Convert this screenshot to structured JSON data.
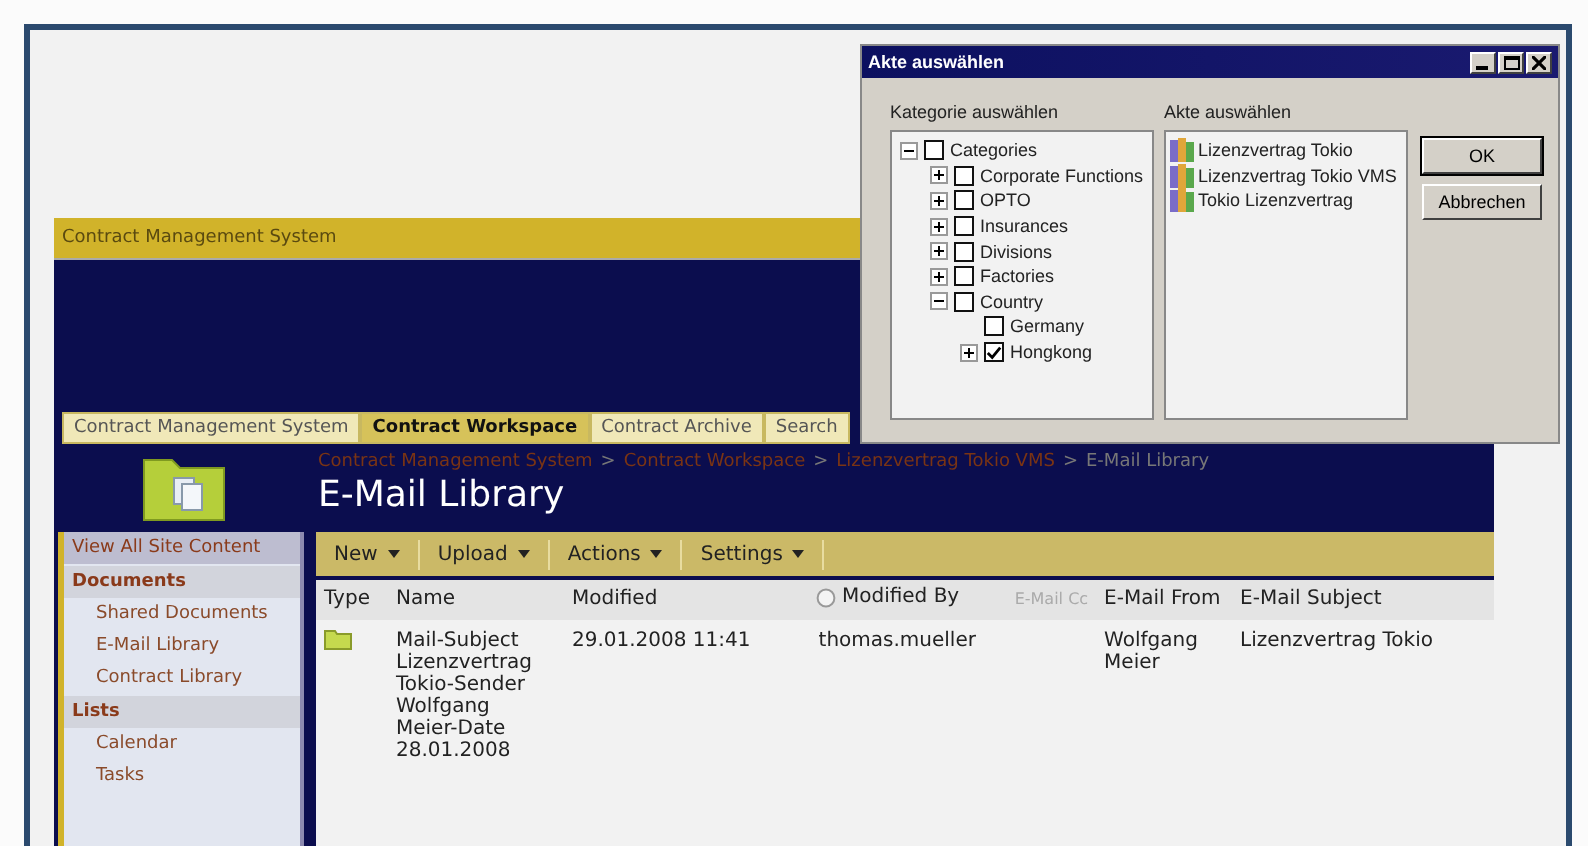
{
  "app": {
    "title": "Contract Management System",
    "tabs": [
      {
        "label": "Contract Management System",
        "selected": false
      },
      {
        "label": "Contract Workspace",
        "selected": true
      },
      {
        "label": "Contract Archive",
        "selected": false
      },
      {
        "label": "Search",
        "selected": false
      }
    ],
    "breadcrumb": [
      {
        "label": "Contract Management System",
        "link": true
      },
      {
        "separator": ">",
        "label": "Contract Workspace",
        "link": true
      },
      {
        "separator": ">",
        "label": "Lizenzvertrag Tokio VMS",
        "link": true
      },
      {
        "separator": ">",
        "label": "E-Mail Library",
        "link": false
      }
    ],
    "page_title": "E-Mail Library",
    "sidebar": {
      "view_all": "View All Site Content",
      "sections": [
        {
          "heading": "Documents",
          "items": [
            "Shared Documents",
            "E-Mail Library",
            "Contract Library"
          ]
        },
        {
          "heading": "Lists",
          "items": [
            "Calendar",
            "Tasks"
          ]
        }
      ]
    },
    "toolbar": [
      "New",
      "Upload",
      "Actions",
      "Settings"
    ],
    "table": {
      "columns": [
        {
          "label": "Type",
          "dimmed": false,
          "icon": false
        },
        {
          "label": "Name",
          "dimmed": false,
          "icon": false
        },
        {
          "label": "Modified",
          "dimmed": false,
          "icon": false
        },
        {
          "label": "Modified By",
          "dimmed": false,
          "icon": true
        },
        {
          "label": "E-Mail Cc",
          "dimmed": true,
          "icon": false
        },
        {
          "label": "E-Mail From",
          "dimmed": false,
          "icon": false
        },
        {
          "label": "E-Mail Subject",
          "dimmed": false,
          "icon": false
        }
      ],
      "rows": [
        {
          "kind": "folder",
          "cells": [
            "",
            "Mail-Subject Lizenzvertrag Tokio-Sender Wolfgang Meier-Date 28.01.2008",
            "29.01.2008 11:41",
            "thomas.mueller",
            "",
            "Wolfgang Meier",
            "Lizenzvertrag Tokio"
          ]
        }
      ]
    }
  },
  "dialog": {
    "title": "Akte auswählen",
    "category_label": "Kategorie auswählen",
    "files_label": "Akte auswählen",
    "tree": [
      {
        "label": "Categories",
        "checked": false,
        "expanded": true,
        "children": [
          {
            "label": "Corporate Functions",
            "checked": false,
            "expanded": false
          },
          {
            "label": "OPTO",
            "checked": false,
            "expanded": false
          },
          {
            "label": "Insurances",
            "checked": false,
            "expanded": false
          },
          {
            "label": "Divisions",
            "checked": false,
            "expanded": false
          },
          {
            "label": "Factories",
            "checked": false,
            "expanded": false
          },
          {
            "label": "Country",
            "checked": false,
            "expanded": true,
            "children": [
              {
                "label": "Germany",
                "checked": false
              },
              {
                "label": "Hongkong",
                "checked": true,
                "expanded": false
              }
            ]
          }
        ]
      }
    ],
    "files": [
      "Lizenzvertrag Tokio",
      "Lizenzvertrag Tokio VMS",
      "Tokio Lizenzvertrag"
    ],
    "buttons": [
      {
        "label": "OK",
        "default": true
      },
      {
        "label": "Abbrechen",
        "default": false
      }
    ]
  }
}
